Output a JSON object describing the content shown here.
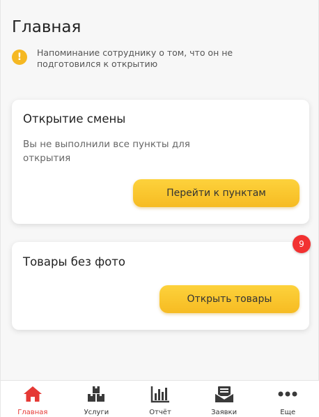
{
  "page": {
    "title": "Главная"
  },
  "notice": {
    "text": "Напоминание сотруднику о том, что он не подготовился к открытию",
    "icon": "exclamation-circle-icon",
    "color": "#f5b823"
  },
  "cards": [
    {
      "title": "Открытие смены",
      "description": "Вы не выполнили все пункты для открытия",
      "button_label": "Перейти к пунктам"
    },
    {
      "title": "Товары без фото",
      "button_label": "Открыть товары",
      "badge": "9"
    }
  ],
  "bottom_nav": {
    "items": [
      {
        "label": "Главная",
        "icon": "home-icon",
        "active": true
      },
      {
        "label": "Услуги",
        "icon": "boxes-icon"
      },
      {
        "label": "Отчёт",
        "icon": "chart-icon"
      },
      {
        "label": "Заявки",
        "icon": "mail-icon"
      },
      {
        "label": "Еще",
        "icon": "more-icon"
      }
    ]
  },
  "colors": {
    "accent": "#e53935",
    "button": "#fcc92e",
    "badge": "#f23131"
  }
}
